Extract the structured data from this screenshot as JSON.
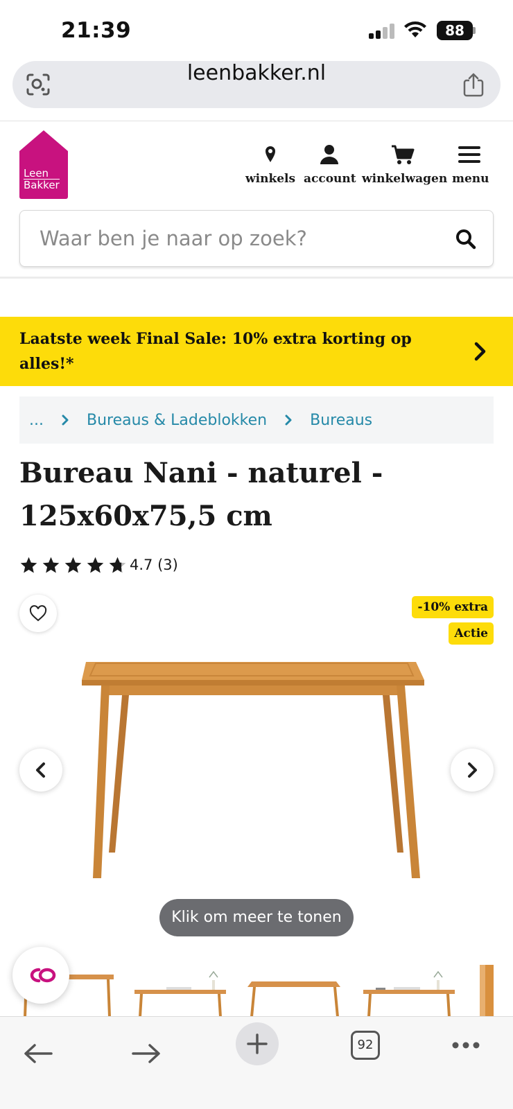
{
  "status_bar": {
    "time": "21:39",
    "battery": "88"
  },
  "browser": {
    "url": "leenbakker.nl",
    "tab_count": "92"
  },
  "header": {
    "logo_text_1": "Leen",
    "logo_text_2": "Bakker",
    "nav": {
      "stores": "winkels",
      "account": "account",
      "cart": "winkelwagen",
      "menu": "menu"
    },
    "search_placeholder": "Waar ben je naar op zoek?"
  },
  "banner": {
    "text": "Laatste week Final Sale: 10% extra korting op alles!*"
  },
  "breadcrumb": {
    "ellipsis": "...",
    "items": [
      "Bureaus & Ladeblokken",
      "Bureaus"
    ]
  },
  "product": {
    "title": "Bureau Nani - naturel - 125x60x75,5 cm",
    "rating": 4.7,
    "rating_text": "4.7 (3)",
    "badges": [
      "-10% extra",
      "Actie"
    ],
    "more_label": "Klik om meer te tonen"
  },
  "colors": {
    "brand": "#c8127f",
    "banner": "#fddc0a",
    "link": "#2589a8",
    "wood": "#d9903e"
  }
}
